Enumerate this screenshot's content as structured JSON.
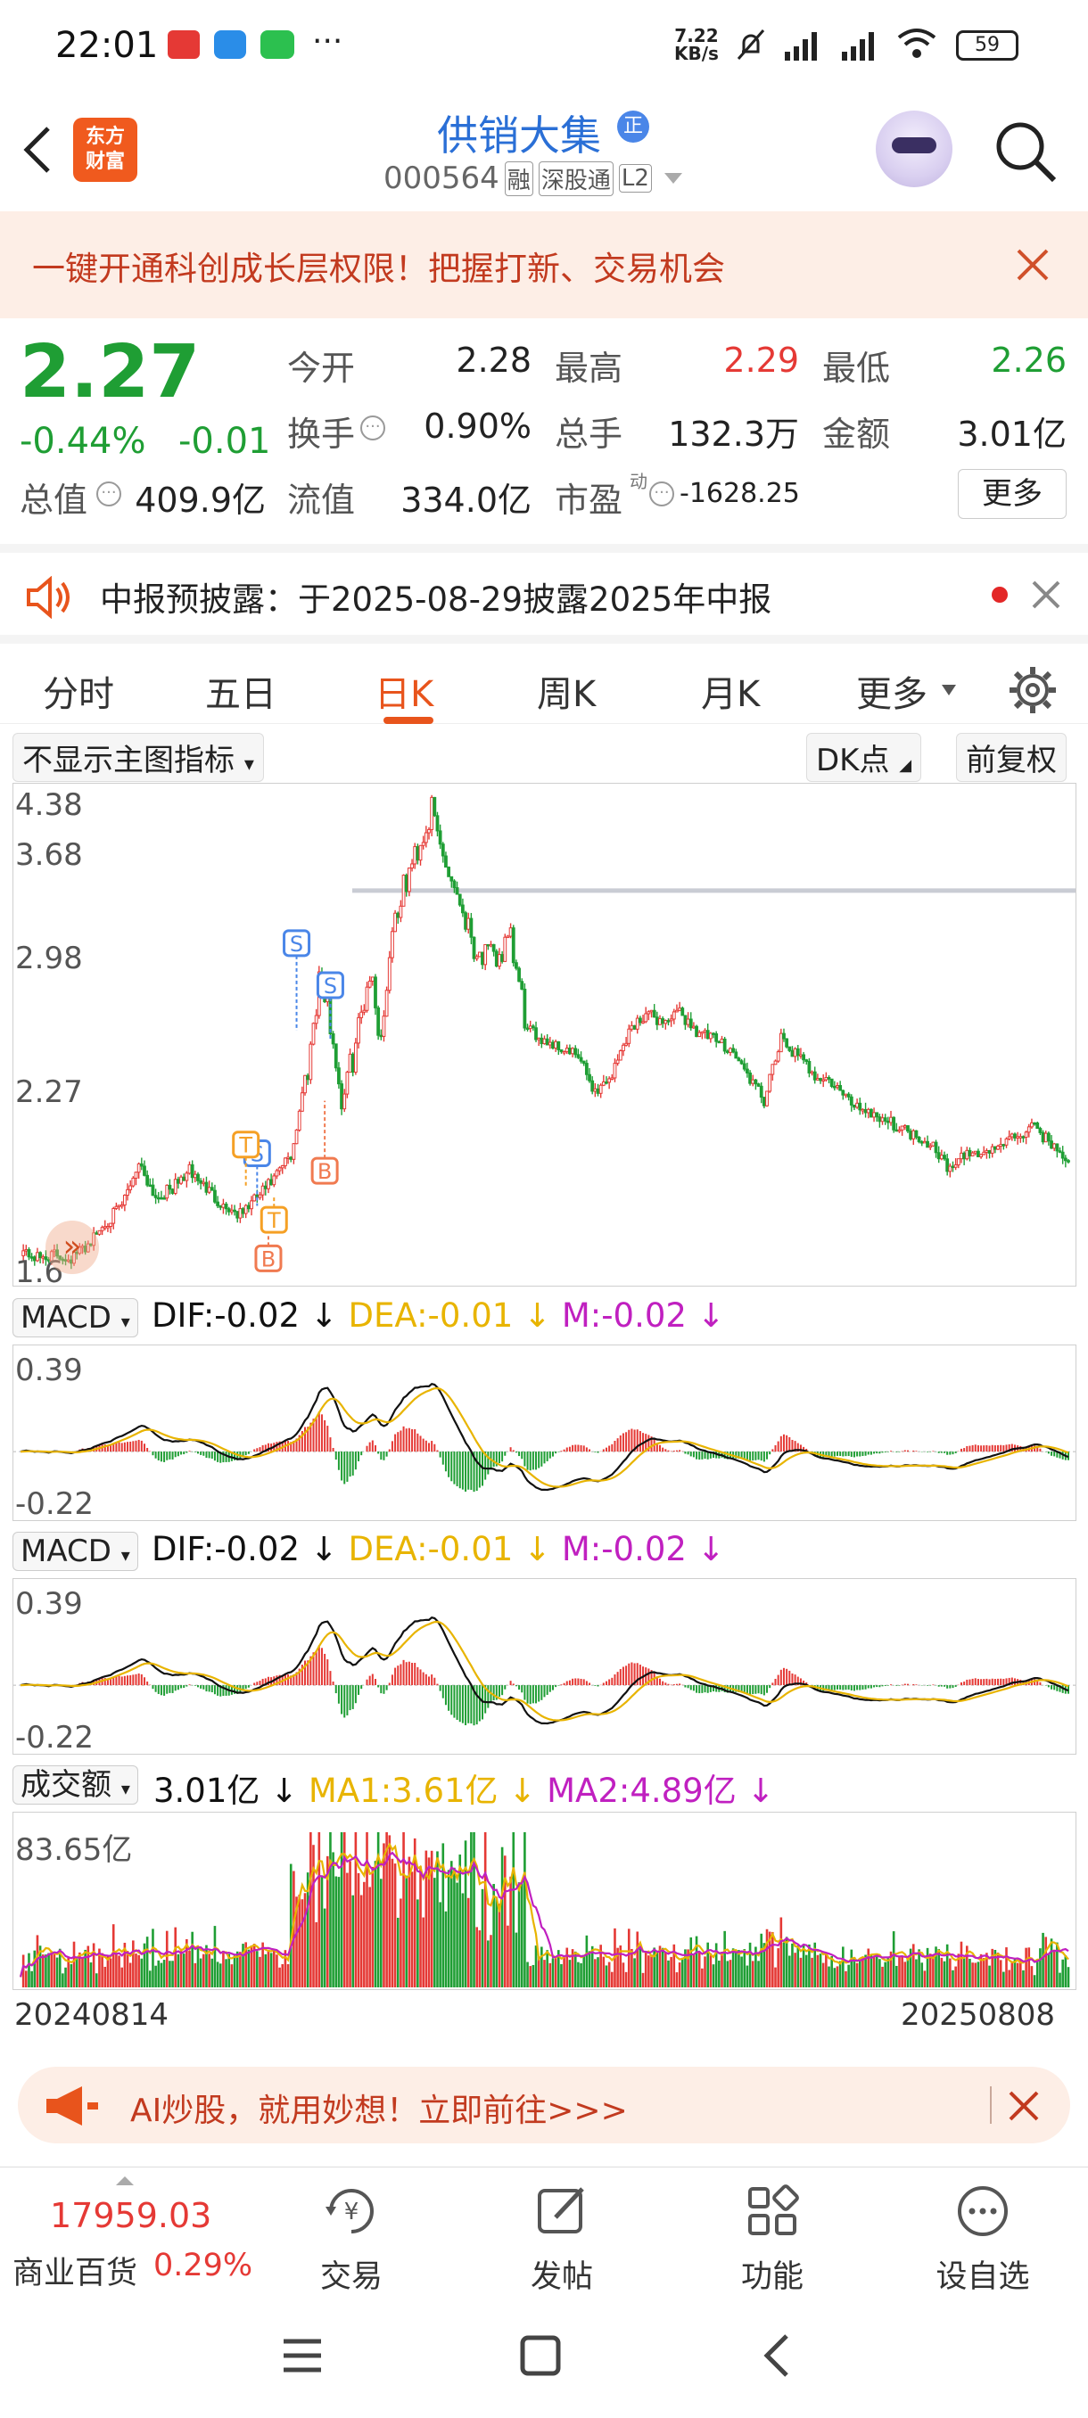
{
  "status": {
    "time": "22:01",
    "net_speed_top": "7.22",
    "net_speed_unit": "KB/s",
    "battery": "59"
  },
  "header": {
    "app_logo_line1": "东方",
    "app_logo_line2": "财富",
    "stock_name": "供销大集",
    "stock_code": "000564",
    "tags": [
      "融",
      "深股通",
      "L2"
    ],
    "badge": "正"
  },
  "promo": {
    "text": "一键开通科创成长层权限！把握打新、交易机会"
  },
  "quote": {
    "price": "2.27",
    "change_pct": "-0.44%",
    "change": "-0.01",
    "labels": {
      "open": "今开",
      "high": "最高",
      "low": "最低",
      "turnover": "换手",
      "volume": "总手",
      "amount": "金额",
      "mktcap": "总值",
      "float": "流值",
      "pe": "市盈",
      "pe_sup": "动"
    },
    "values": {
      "open": "2.28",
      "high": "2.29",
      "low": "2.26",
      "turnover": "0.90%",
      "volume": "132.3万",
      "amount": "3.01亿",
      "mktcap": "409.9亿",
      "float": "334.0亿",
      "pe": "-1628.25"
    },
    "more_button": "更多"
  },
  "notice": {
    "text": "中报预披露：于2025-08-29披露2025年中报"
  },
  "tabs": {
    "items": [
      "分时",
      "五日",
      "日K",
      "周K",
      "月K",
      "更多"
    ],
    "active": "日K"
  },
  "chart_controls": {
    "indicator_select": "不显示主图指标",
    "dk_button": "DK点",
    "adjust_button": "前复权"
  },
  "chart_data": [
    {
      "type": "candlestick",
      "title": "",
      "ylim": [
        1.6,
        4.38
      ],
      "y_ticks": [
        "4.38",
        "3.68",
        "2.98",
        "2.27"
      ],
      "y_tick_bottom_partial": "1.6",
      "reference_line": 3.8,
      "start_date": "20240814",
      "end_date": "20250808",
      "markers": [
        "S",
        "S",
        "S",
        "B",
        "B",
        "T",
        "T"
      ],
      "shape_points": [
        [
          0,
          1.75
        ],
        [
          6,
          1.7
        ],
        [
          12,
          1.72
        ],
        [
          18,
          1.7
        ],
        [
          24,
          1.78
        ],
        [
          30,
          1.9
        ],
        [
          36,
          2.0
        ],
        [
          42,
          2.25
        ],
        [
          48,
          2.05
        ],
        [
          54,
          2.1
        ],
        [
          60,
          2.2
        ],
        [
          66,
          2.1
        ],
        [
          72,
          2.0
        ],
        [
          78,
          1.95
        ],
        [
          84,
          2.05
        ],
        [
          90,
          2.15
        ],
        [
          96,
          2.3
        ],
        [
          102,
          2.8
        ],
        [
          106,
          3.3
        ],
        [
          110,
          3.05
        ],
        [
          114,
          2.6
        ],
        [
          118,
          2.85
        ],
        [
          124,
          3.35
        ],
        [
          128,
          2.95
        ],
        [
          132,
          3.6
        ],
        [
          136,
          3.8
        ],
        [
          140,
          4.0
        ],
        [
          146,
          4.25
        ],
        [
          150,
          4.0
        ],
        [
          156,
          3.75
        ],
        [
          162,
          3.45
        ],
        [
          168,
          3.4
        ],
        [
          174,
          3.5
        ],
        [
          180,
          3.0
        ],
        [
          186,
          2.95
        ],
        [
          192,
          2.9
        ],
        [
          198,
          2.85
        ],
        [
          204,
          2.65
        ],
        [
          210,
          2.75
        ],
        [
          216,
          3.0
        ],
        [
          222,
          3.1
        ],
        [
          228,
          3.05
        ],
        [
          234,
          3.1
        ],
        [
          240,
          3.0
        ],
        [
          246,
          2.95
        ],
        [
          252,
          2.9
        ],
        [
          258,
          2.75
        ],
        [
          264,
          2.6
        ],
        [
          270,
          2.95
        ],
        [
          276,
          2.85
        ],
        [
          282,
          2.75
        ],
        [
          288,
          2.7
        ],
        [
          294,
          2.6
        ],
        [
          300,
          2.55
        ],
        [
          306,
          2.5
        ],
        [
          312,
          2.45
        ],
        [
          318,
          2.4
        ],
        [
          324,
          2.35
        ],
        [
          330,
          2.2
        ],
        [
          336,
          2.3
        ],
        [
          342,
          2.3
        ],
        [
          348,
          2.35
        ],
        [
          354,
          2.4
        ],
        [
          360,
          2.45
        ],
        [
          366,
          2.35
        ],
        [
          372,
          2.27
        ]
      ]
    },
    {
      "type": "line",
      "title": "MACD",
      "labels": {
        "dif": "DIF:-0.02",
        "dea": "DEA:-0.01",
        "m": "M:-0.02"
      },
      "y_ticks": [
        "0.39",
        "-0.22"
      ],
      "ylim": [
        -0.22,
        0.39
      ]
    },
    {
      "type": "line",
      "title": "MACD",
      "labels": {
        "dif": "DIF:-0.02",
        "dea": "DEA:-0.01",
        "m": "M:-0.02"
      },
      "y_ticks": [
        "0.39",
        "-0.22"
      ],
      "ylim": [
        -0.22,
        0.39
      ]
    },
    {
      "type": "bar",
      "title": "成交额",
      "labels": {
        "value": "3.01亿",
        "ma1": "MA1:3.61亿",
        "ma2": "MA2:4.89亿"
      },
      "y_ticks": [
        "83.65亿"
      ],
      "x_ticks": [
        "20240814",
        "20250808"
      ]
    }
  ],
  "ai_bar": {
    "text": "AI炒股，就用妙想！立即前往>>>"
  },
  "toolbar": {
    "index_value": "17959.03",
    "index_name": "商业百货",
    "index_change": "0.29%",
    "items": [
      "交易",
      "发帖",
      "功能",
      "设自选"
    ]
  },
  "colors": {
    "up": "#e53935",
    "down": "#1f9e34",
    "accent": "#e8541c",
    "dea": "#e8b400",
    "m": "#c020c0"
  }
}
